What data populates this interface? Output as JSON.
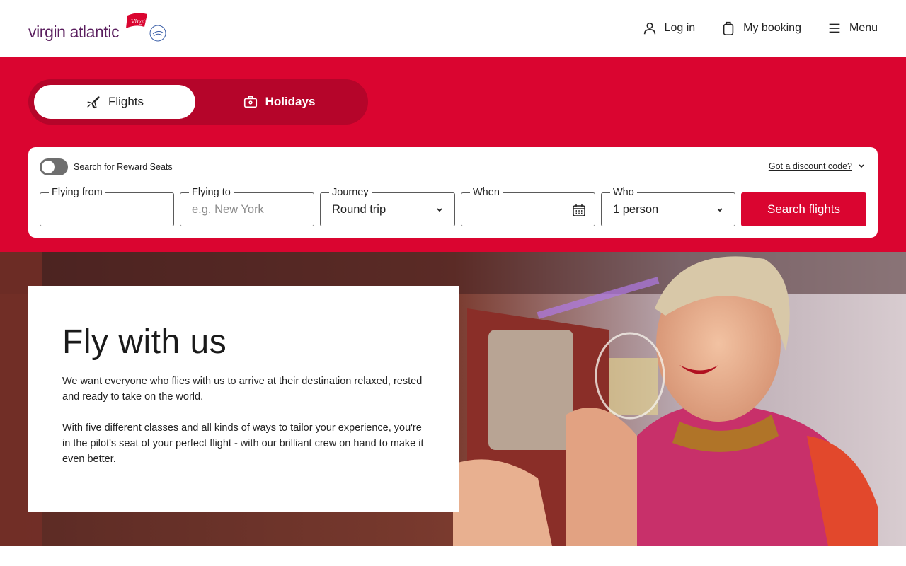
{
  "header": {
    "logo_text": "virgin atlantic",
    "logo_flag_text": "Virgin",
    "nav": {
      "login": "Log in",
      "booking": "My booking",
      "menu": "Menu"
    }
  },
  "mode": {
    "flights": "Flights",
    "holidays": "Holidays",
    "selected": "Flights"
  },
  "search": {
    "reward_label": "Search for Reward Seats",
    "reward_on": false,
    "discount_label": "Got a discount code?",
    "from": {
      "label": "Flying from",
      "value": ""
    },
    "to": {
      "label": "Flying to",
      "placeholder": "e.g. New York"
    },
    "journey": {
      "label": "Journey",
      "value": "Round trip"
    },
    "when": {
      "label": "When",
      "value": ""
    },
    "who": {
      "label": "Who",
      "value": "1 person"
    },
    "button": "Search flights"
  },
  "hero": {
    "title": "Fly with us",
    "paragraph1": "We want everyone who flies with us to arrive at their destination relaxed, rested and ready to take on the world.",
    "paragraph2": "With five different classes and all kinds of ways to tailor your experience, you're in the pilot's seat of your perfect flight - with our brilliant crew on hand to make it even better."
  },
  "colors": {
    "brand_red": "#da0530",
    "brand_purple": "#5a1e5e"
  },
  "icons": [
    "user-icon",
    "bag-icon",
    "menu-icon",
    "plane-icon",
    "suitcase-icon",
    "chevron-down-icon",
    "calendar-icon"
  ]
}
